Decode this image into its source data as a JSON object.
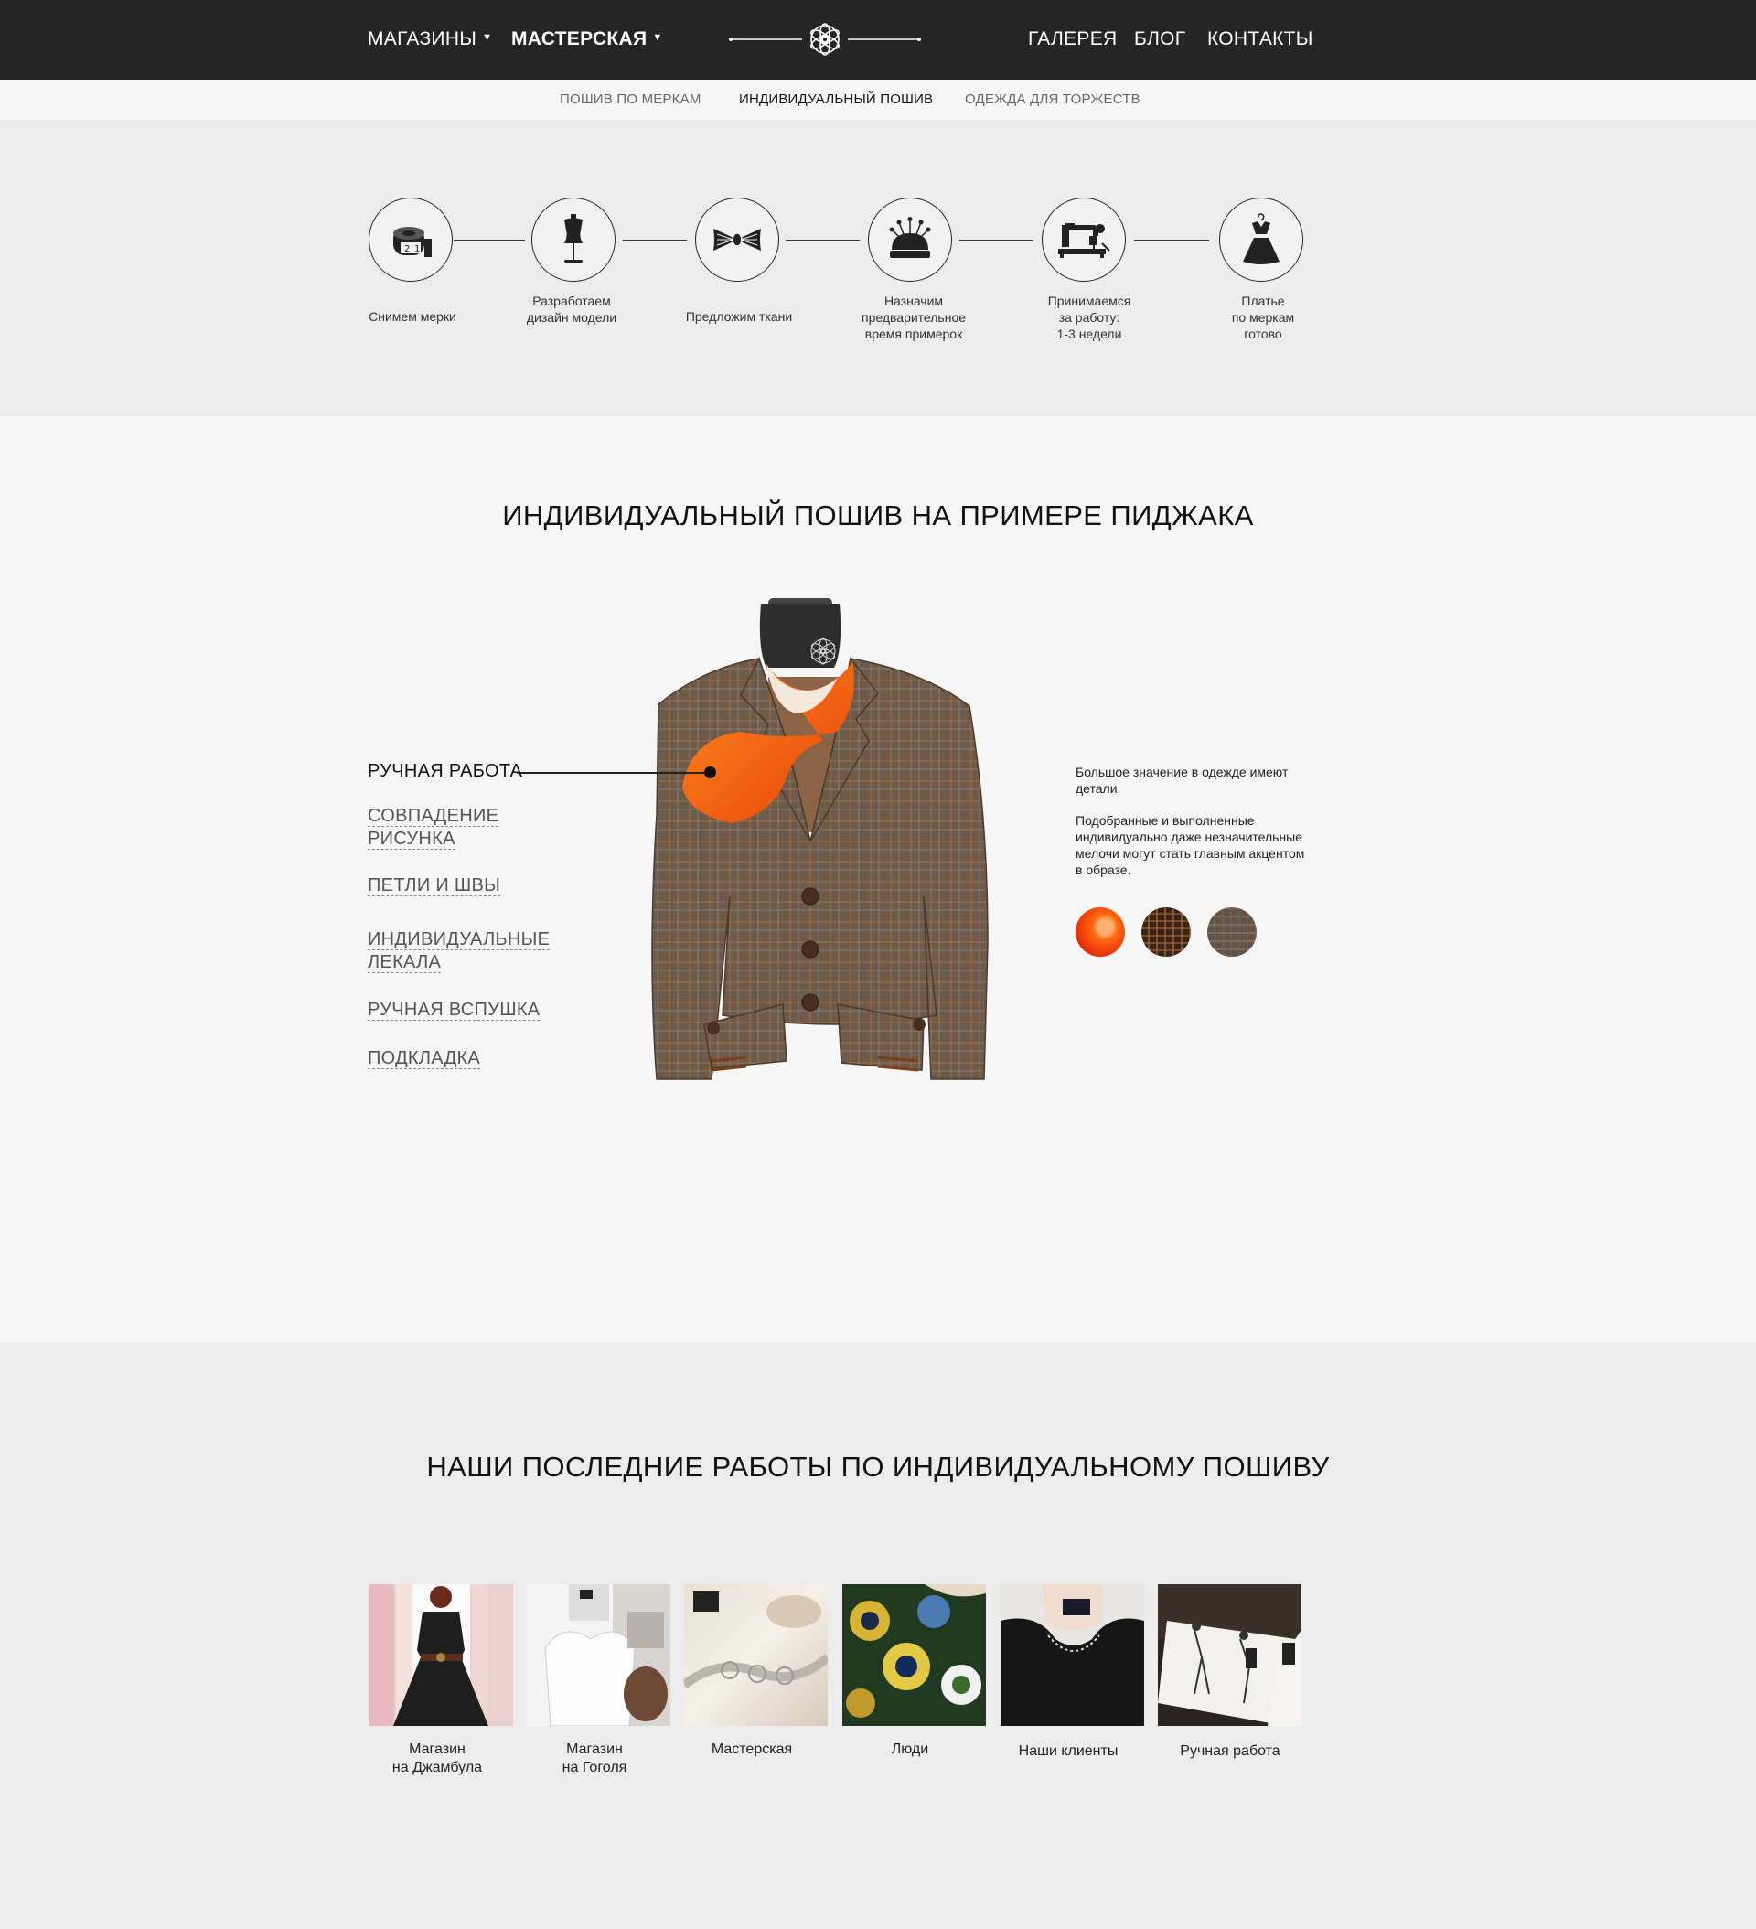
{
  "nav": {
    "shops": "МАГАЗИНЫ",
    "workshop": "МАСТЕРСКАЯ",
    "gallery": "ГАЛЕРЕЯ",
    "blog": "БЛОГ",
    "contacts": "КОНТАКТЫ",
    "caret_icon": "▼"
  },
  "subnav": {
    "measure": "ПОШИВ ПО МЕРКАМ",
    "individual": "ИНДИВИДУАЛЬНЫЙ ПОШИВ",
    "celebration": "ОДЕЖДА ДЛЯ ТОРЖЕСТВ"
  },
  "steps": [
    {
      "icon": "tape-measure-icon",
      "label": "Снимем мерки"
    },
    {
      "icon": "mannequin-icon",
      "label": "Разработаем\nдизайн модели"
    },
    {
      "icon": "fabric-roll-icon",
      "label": "Предложим ткани"
    },
    {
      "icon": "pincushion-icon",
      "label": "Назначим\nпредварительное\nвремя примерок"
    },
    {
      "icon": "sewing-machine-icon",
      "label": "Принимаемся\nза работу:\n1-3 недели"
    },
    {
      "icon": "dress-icon",
      "label": "Платье\nпо меркам\nготово"
    }
  ],
  "jacket": {
    "title": "ИНДИВИДУАЛЬНЫЙ ПОШИВ НА ПРИМЕРЕ ПИДЖАКА",
    "features": [
      {
        "line1": "РУЧНАЯ РАБОТА",
        "line2": "",
        "active": true
      },
      {
        "line1": "СОВПАДЕНИЕ",
        "line2": "РИСУНКА",
        "active": false
      },
      {
        "line1": "ПЕТЛИ И ШВЫ",
        "line2": "",
        "active": false
      },
      {
        "line1": "ИНДИВИДУАЛЬНЫЕ",
        "line2": "ЛЕКАЛА",
        "active": false
      },
      {
        "line1": "РУЧНАЯ ВСПУШКА",
        "line2": "",
        "active": false
      },
      {
        "line1": "ПОДКЛАДКА",
        "line2": "",
        "active": false
      }
    ],
    "desc1": "Большое значение в одежде имеют детали.",
    "desc2": "Подобранные и выполненные индивидуально даже незначительные мелочи могут стать главным акцентом в образе.",
    "swatches": [
      {
        "name": "orange-silk",
        "color": "#f05a12"
      },
      {
        "name": "brown-plaid",
        "color": "#5a3a22"
      },
      {
        "name": "grey-plaid",
        "color": "#6b5f55"
      }
    ]
  },
  "works": {
    "title": "НАШИ ПОСЛЕДНИЕ РАБОТЫ ПО ИНДИВИДУАЛЬНОМУ ПОШИВУ",
    "items": [
      {
        "label": "Магазин\nна Джамбула"
      },
      {
        "label": "Магазин\nна Гоголя"
      },
      {
        "label": "Мастерская"
      },
      {
        "label": "Люди"
      },
      {
        "label": "Наши клиенты"
      },
      {
        "label": "Ручная работа"
      }
    ]
  },
  "colors": {
    "topbar": "#252525",
    "accent_orange": "#f26a1b",
    "jacket_brown": "#6e5a48"
  }
}
